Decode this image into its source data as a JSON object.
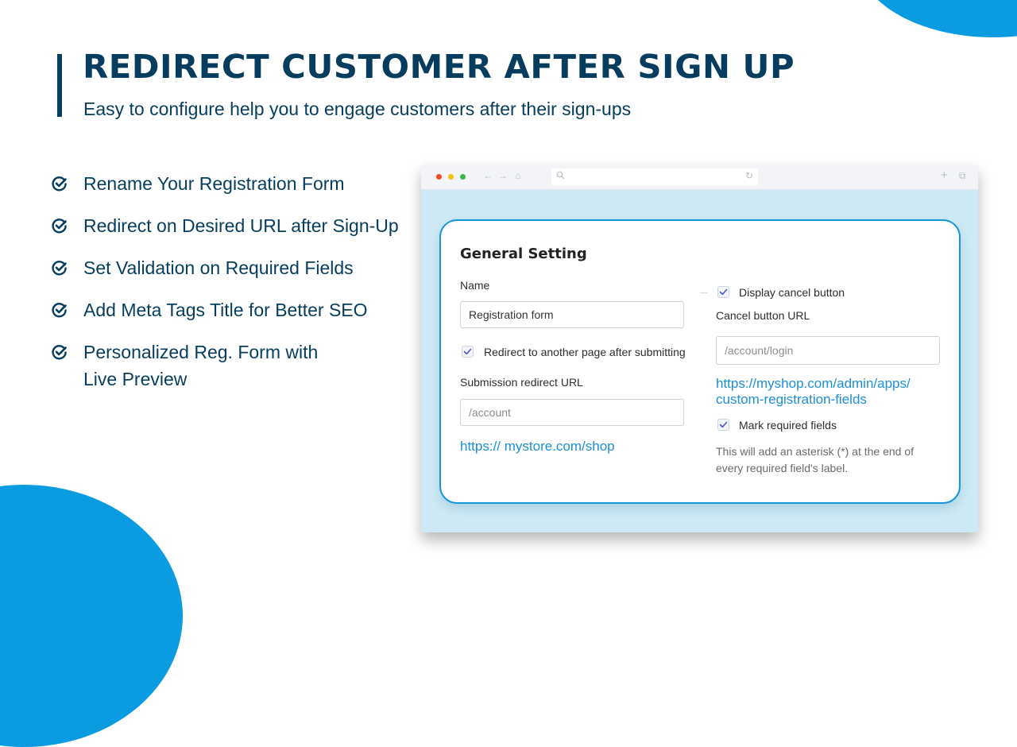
{
  "hero": {
    "title": "REDIRECT CUSTOMER AFTER SIGN UP",
    "subtitle": "Easy to configure help you to engage customers after their sign-ups"
  },
  "features": [
    {
      "icon": "check-circle-icon",
      "text": "Rename Your Registration Form"
    },
    {
      "icon": "check-circle-icon",
      "text": "Redirect on Desired URL after Sign-Up"
    },
    {
      "icon": "check-circle-icon",
      "text": "Set Validation on Required Fields"
    },
    {
      "icon": "check-circle-icon",
      "text": "Add Meta Tags Title for Better SEO"
    },
    {
      "icon": "check-circle-icon",
      "text_line1": "Personalized Reg. Form with",
      "text_line2": "Live Preview"
    }
  ],
  "browser": {
    "window_controls": [
      "close",
      "minimize",
      "maximize"
    ],
    "nav_icons": {
      "back": "←",
      "forward": "→",
      "home": "⌂",
      "search": "⚲",
      "reload": "↻",
      "new_tab": "+",
      "tabs": "⧉"
    }
  },
  "colors": {
    "brand_dark": "#063d5e",
    "accent_blue": "#0a9be0",
    "link_blue": "#1c8fd6",
    "browser_bg": "#cde9f5",
    "checkbox_check": "#4b57c6"
  },
  "settings": {
    "heading": "General Setting",
    "name_label": "Name",
    "name_value": "Registration form",
    "redirect_checkbox": {
      "label": "Redirect to another page after  submitting",
      "checked": true
    },
    "submission_label": "Submission redirect URL",
    "submission_placeholder": "/account",
    "submission_link": "https:// mystore.com/shop",
    "cancel_checkbox": {
      "label": "Display cancel button",
      "checked": true
    },
    "cancel_url_label": "Cancel button URL",
    "cancel_url_placeholder": "/account/login",
    "cancel_link_line1": "https://myshop.com/admin/apps/",
    "cancel_link_line2": "custom-registration-fields",
    "mark_required_checkbox": {
      "label": "Mark required fields",
      "checked": true
    },
    "mark_required_help_line1": "This will add an asterisk (*) at the end of",
    "mark_required_help_line2": "every required field's label."
  }
}
